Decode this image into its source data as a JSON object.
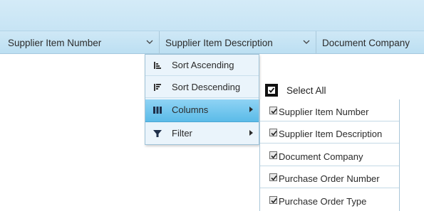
{
  "grid": {
    "columns": [
      {
        "label": "Supplier Item Number"
      },
      {
        "label": "Supplier Item Description"
      },
      {
        "label": "Document Company"
      }
    ]
  },
  "column_menu": {
    "items": [
      {
        "label": "Sort Ascending",
        "icon": "sort-ascending-icon"
      },
      {
        "label": "Sort Descending",
        "icon": "sort-descending-icon"
      },
      {
        "label": "Columns",
        "icon": "columns-icon",
        "selected": true,
        "has_submenu": true
      },
      {
        "label": "Filter",
        "icon": "filter-icon",
        "has_submenu": true
      }
    ]
  },
  "columns_submenu": {
    "select_all_label": "Select All",
    "select_all_checked": true,
    "items": [
      {
        "label": "Supplier Item Number",
        "checked": true
      },
      {
        "label": "Supplier Item Description",
        "checked": true
      },
      {
        "label": "Document Company",
        "checked": true
      },
      {
        "label": "Purchase Order Number",
        "checked": true
      },
      {
        "label": "Purchase Order Type",
        "checked": true
      }
    ]
  },
  "colors": {
    "header_bg": "#c7e4f4",
    "menu_bg": "#eaf4fb",
    "selected_bg": "#5bbbe8"
  }
}
